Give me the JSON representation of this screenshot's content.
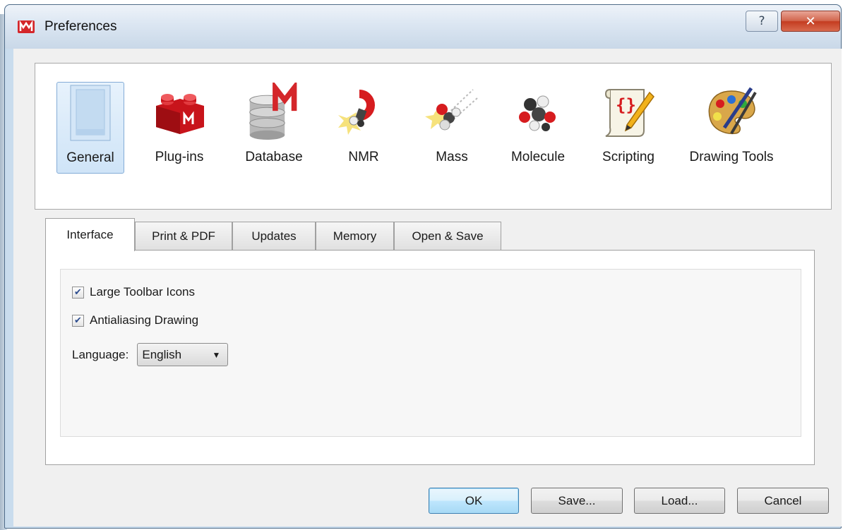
{
  "window": {
    "title": "Preferences",
    "help_glyph": "?",
    "close_glyph": "✕"
  },
  "categories": [
    {
      "label": "General",
      "icon": "general-panel-icon",
      "selected": true
    },
    {
      "label": "Plug-ins",
      "icon": "plugin-lego-icon"
    },
    {
      "label": "Database",
      "icon": "database-icon"
    },
    {
      "label": "NMR",
      "icon": "nmr-magnet-icon"
    },
    {
      "label": "Mass",
      "icon": "mass-molecules-icon"
    },
    {
      "label": "Molecule",
      "icon": "molecule-icon"
    },
    {
      "label": "Scripting",
      "icon": "scripting-scroll-icon"
    },
    {
      "label": "Drawing Tools",
      "icon": "palette-icon"
    }
  ],
  "tabs": [
    "Interface",
    "Print & PDF",
    "Updates",
    "Memory",
    "Open & Save"
  ],
  "active_tab": "Interface",
  "interface": {
    "large_toolbar_icons": {
      "label": "Large Toolbar Icons",
      "checked": true
    },
    "antialiasing_drawing": {
      "label": "Antialiasing Drawing",
      "checked": true
    },
    "language": {
      "label": "Language:",
      "value": "English"
    }
  },
  "buttons": {
    "ok": "OK",
    "save": "Save...",
    "load": "Load...",
    "cancel": "Cancel"
  },
  "colors": {
    "selected_category_border": "#84acd7",
    "close_button": "#c43c20",
    "default_button_border": "#3c7fb1"
  }
}
